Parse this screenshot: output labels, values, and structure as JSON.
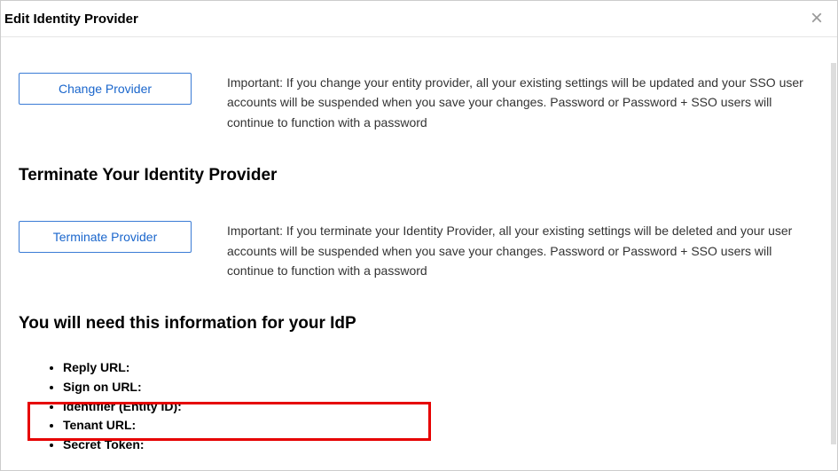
{
  "dialog": {
    "title": "Edit Identity Provider"
  },
  "changeProvider": {
    "buttonLabel": "Change Provider",
    "importantText": "Important: If you change your entity provider, all your existing settings will be updated and your SSO user accounts will be suspended when you save your changes. Password or Password + SSO users will continue to function with a password"
  },
  "terminateProvider": {
    "heading": "Terminate Your Identity Provider",
    "buttonLabel": "Terminate Provider",
    "importantText": "Important: If you terminate your Identity Provider, all your existing settings will be deleted and your user accounts will be suspended when you save your changes. Password or Password + SSO users will continue to function with a password"
  },
  "idpInfo": {
    "heading": "You will need this information for your IdP",
    "items": {
      "replyUrl": "Reply URL:",
      "signOnUrl": "Sign on URL:",
      "identifier": "Identifier (Entity ID):",
      "tenantUrl": "Tenant URL:",
      "secretToken": "Secret Token:"
    }
  }
}
